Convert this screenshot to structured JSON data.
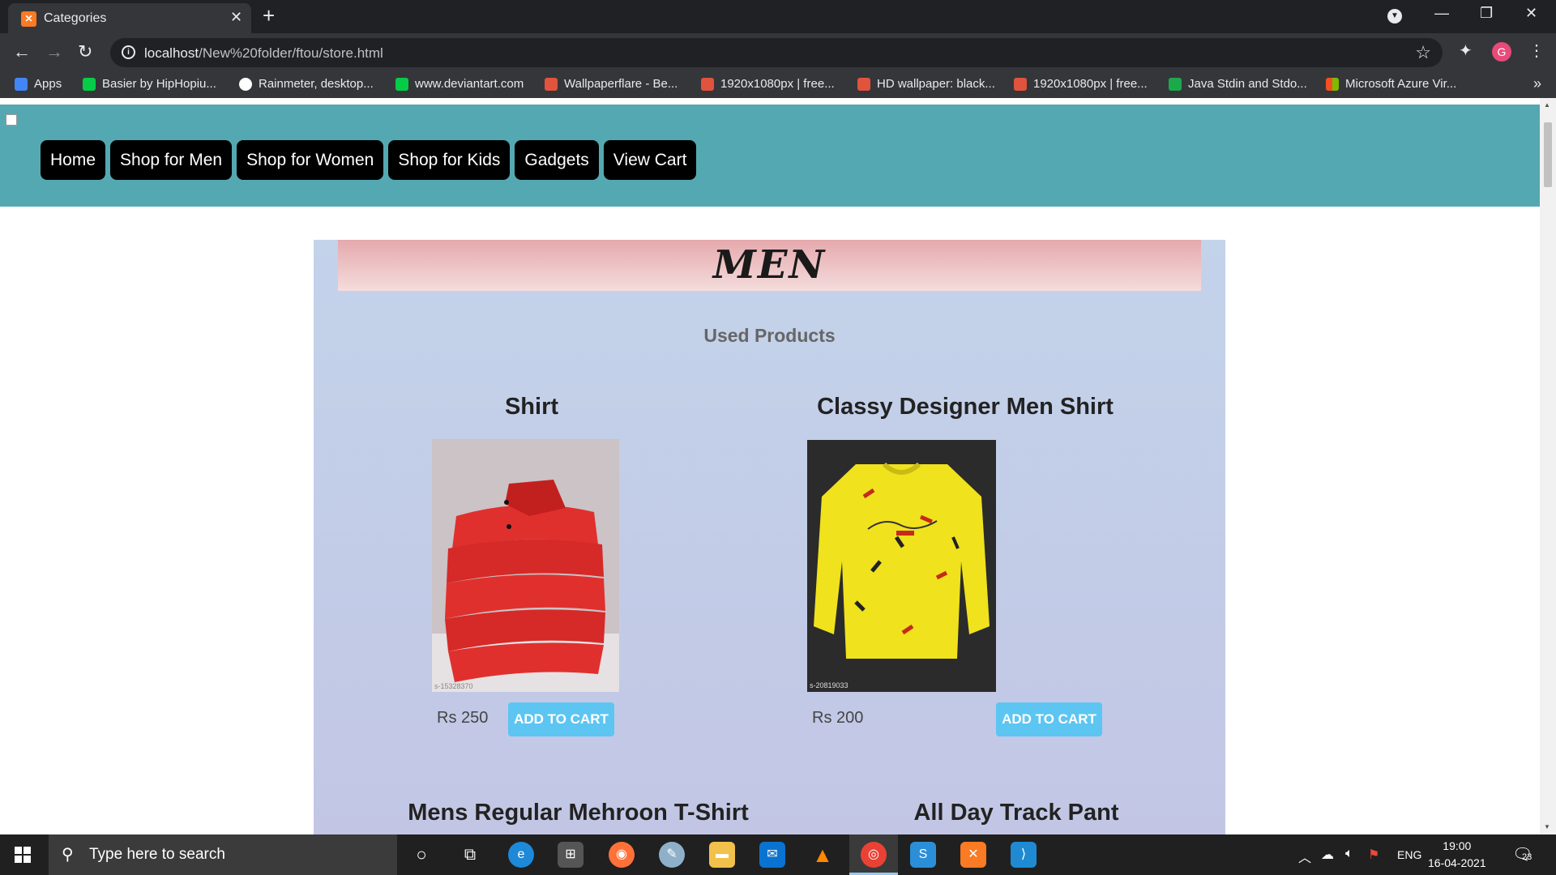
{
  "browser": {
    "tab_title": "Categories",
    "tab_icon": "xampp-icon",
    "url_host": "localhost",
    "url_path": "/New%20folder/ftou/store.html",
    "profile_initial": "G"
  },
  "bookmarks": [
    {
      "label": "Apps",
      "icon": "apps-grid-icon",
      "color": "#4285f4"
    },
    {
      "label": "Basier by HipHopiu...",
      "icon": "deviantart-icon",
      "color": "#05cc47"
    },
    {
      "label": "Rainmeter, desktop...",
      "icon": "rainmeter-icon",
      "color": "#ffffff"
    },
    {
      "label": "www.deviantart.com",
      "icon": "deviantart-icon",
      "color": "#05cc47"
    },
    {
      "label": "Wallpaperflare - Be...",
      "icon": "flame-icon",
      "color": "#e0533d"
    },
    {
      "label": "1920x1080px | free...",
      "icon": "flame-icon",
      "color": "#e0533d"
    },
    {
      "label": "HD wallpaper: black...",
      "icon": "flame-icon",
      "color": "#e0533d"
    },
    {
      "label": "1920x1080px | free...",
      "icon": "flame-icon",
      "color": "#e0533d"
    },
    {
      "label": "Java Stdin and Stdo...",
      "icon": "hackerrank-icon",
      "color": "#1ba94c"
    },
    {
      "label": "Microsoft Azure Vir...",
      "icon": "microsoft-icon",
      "color": "#f25022"
    }
  ],
  "nav": [
    "Home",
    "Shop for Men",
    "Shop for Women",
    "Shop for Kids",
    "Gadgets",
    "View Cart"
  ],
  "page": {
    "banner_title": "MEN",
    "subtitle": "Used Products"
  },
  "products": [
    {
      "name": "Shirt",
      "price": "Rs 250",
      "button": "ADD TO CART",
      "image": "red-shirts-stack-image"
    },
    {
      "name": "Classy Designer Men Shirt",
      "price": "Rs 200",
      "button": "ADD TO CART",
      "image": "yellow-printed-shirt-image"
    },
    {
      "name": "Mens Regular Mehroon T-Shirt"
    },
    {
      "name": "All Day Track Pant"
    }
  ],
  "image_watermarks": [
    "s-15328370",
    "s-20819033"
  ],
  "taskbar": {
    "search_placeholder": "Type here to search",
    "language": "ENG",
    "time": "19:00",
    "date": "16-04-2021",
    "notification_count": "23"
  },
  "colors": {
    "header_bg": "#54a8b2",
    "cart_button": "#5cc5f2",
    "nav_button": "#000000"
  }
}
